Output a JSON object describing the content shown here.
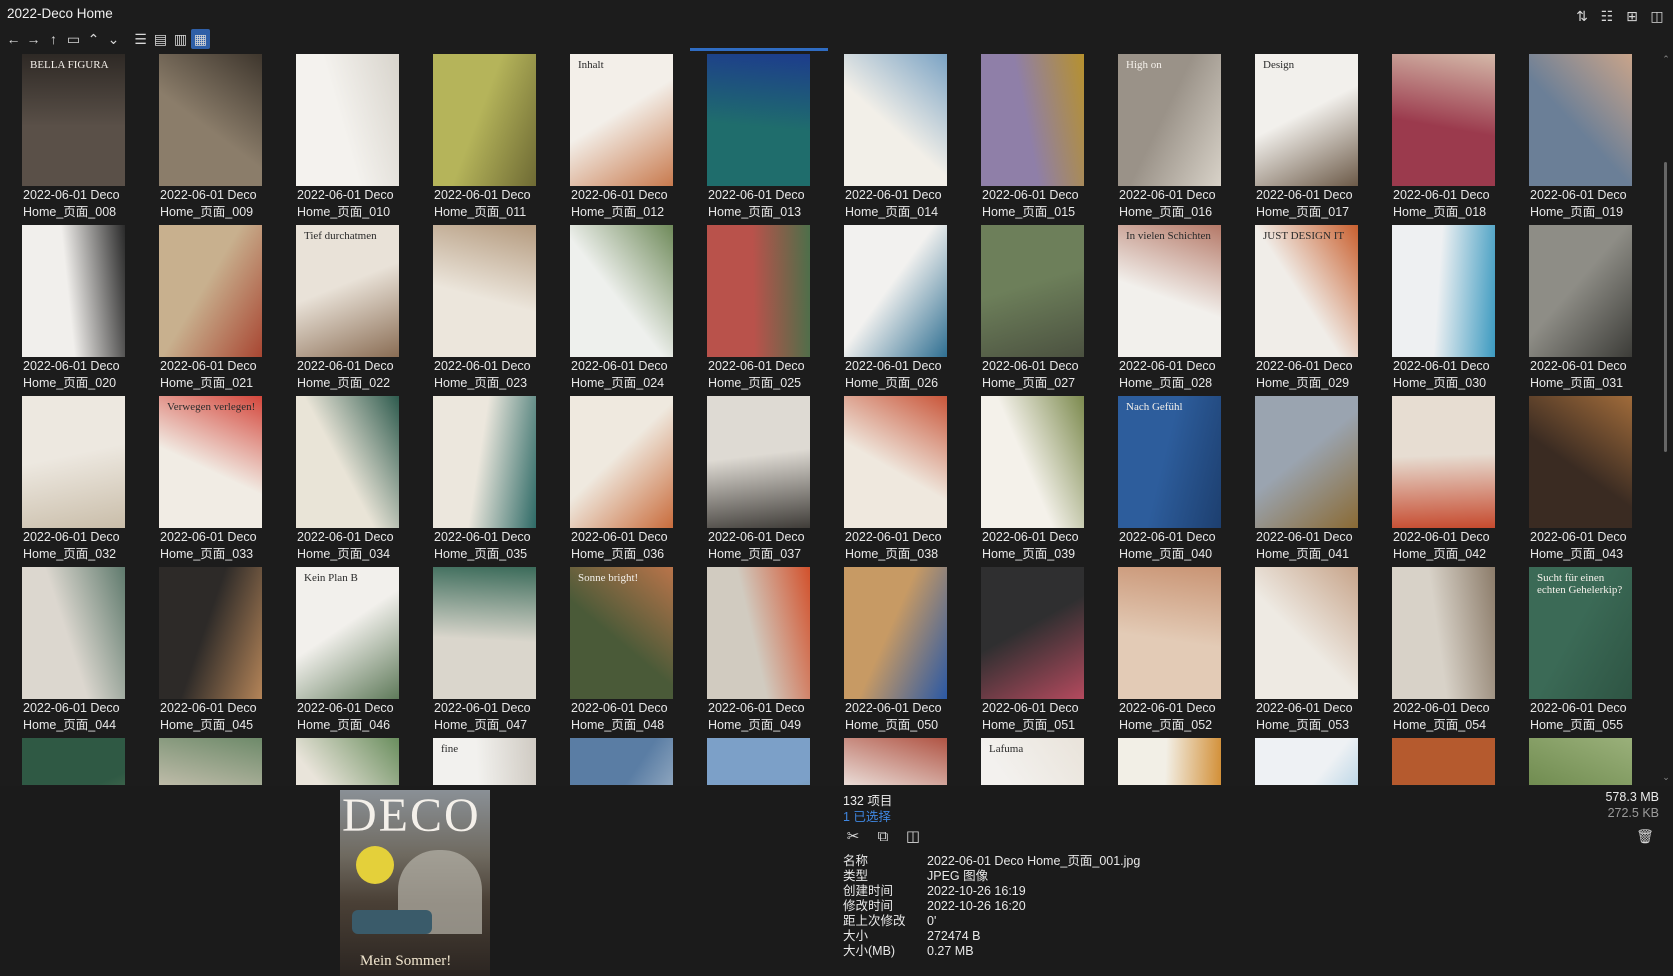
{
  "window": {
    "title": "2022-Deco Home"
  },
  "toolbar": {
    "nav": [
      {
        "name": "back-icon",
        "glyph": "←"
      },
      {
        "name": "forward-icon",
        "glyph": "→"
      },
      {
        "name": "up-icon",
        "glyph": "↑"
      },
      {
        "name": "new-folder-icon",
        "glyph": "▭"
      },
      {
        "name": "chevron-up-icon",
        "glyph": "⌃"
      },
      {
        "name": "chevron-down-icon",
        "glyph": "⌄"
      }
    ],
    "views": [
      {
        "name": "list-view-icon",
        "glyph": "☰",
        "active": false
      },
      {
        "name": "details-view-icon",
        "glyph": "▤",
        "active": false
      },
      {
        "name": "tiles-view-icon",
        "glyph": "▥",
        "active": false
      },
      {
        "name": "grid-view-icon",
        "glyph": "▦",
        "active": true
      }
    ]
  },
  "window_actions": [
    {
      "name": "sort-icon",
      "glyph": "⇅"
    },
    {
      "name": "tree-view-icon",
      "glyph": "☷"
    },
    {
      "name": "add-pane-icon",
      "glyph": "⊞"
    },
    {
      "name": "layout-icon",
      "glyph": "◫"
    }
  ],
  "files": [
    {
      "line1": "2022-06-01 Deco",
      "line2": "Home_页面_008",
      "c1": "#5a5048",
      "c2": "#2e2925",
      "text": "BELLA FIGURA"
    },
    {
      "line1": "2022-06-01 Deco",
      "line2": "Home_页面_009",
      "c1": "#8b7d6a",
      "c2": "#3e362d",
      "text": ""
    },
    {
      "line1": "2022-06-01 Deco",
      "line2": "Home_页面_010",
      "c1": "#f4f2ee",
      "c2": "#d8d4cc",
      "text": ""
    },
    {
      "line1": "2022-06-01 Deco",
      "line2": "Home_页面_011",
      "c1": "#b5b45a",
      "c2": "#6e6a34",
      "text": ""
    },
    {
      "line1": "2022-06-01 Deco",
      "line2": "Home_页面_012",
      "c1": "#f3efe9",
      "c2": "#c87a4e",
      "text": "Inhalt"
    },
    {
      "line1": "2022-06-01 Deco",
      "line2": "Home_页面_013",
      "c1": "#1f6d6c",
      "c2": "#1d3c8c",
      "text": ""
    },
    {
      "line1": "2022-06-01 Deco",
      "line2": "Home_页面_014",
      "c1": "#f2efe8",
      "c2": "#7ba3c4",
      "text": ""
    },
    {
      "line1": "2022-06-01 Deco",
      "line2": "Home_页面_015",
      "c1": "#8f7fa8",
      "c2": "#b6912e",
      "text": ""
    },
    {
      "line1": "2022-06-01 Deco",
      "line2": "Home_页面_016",
      "c1": "#9a9288",
      "c2": "#d8d2c8",
      "text": "High on"
    },
    {
      "line1": "2022-06-01 Deco",
      "line2": "Home_页面_017",
      "c1": "#f2f0ec",
      "c2": "#6c5a48",
      "text": "Design"
    },
    {
      "line1": "2022-06-01 Deco",
      "line2": "Home_页面_018",
      "c1": "#9b3a4d",
      "c2": "#d4b8a8",
      "text": ""
    },
    {
      "line1": "2022-06-01 Deco",
      "line2": "Home_页面_019",
      "c1": "#6b7f97",
      "c2": "#c9a48a",
      "text": ""
    },
    {
      "line1": "2022-06-01 Deco",
      "line2": "Home_页面_020",
      "c1": "#f1efec",
      "c2": "#2a2a2a",
      "text": ""
    },
    {
      "line1": "2022-06-01 Deco",
      "line2": "Home_页面_021",
      "c1": "#c8b08e",
      "c2": "#a84632",
      "text": ""
    },
    {
      "line1": "2022-06-01 Deco",
      "line2": "Home_页面_022",
      "c1": "#e9e2d8",
      "c2": "#8a6d54",
      "text": "Tief durchatmen"
    },
    {
      "line1": "2022-06-01 Deco",
      "line2": "Home_页面_023",
      "c1": "#ece6dc",
      "c2": "#b49a7e",
      "text": ""
    },
    {
      "line1": "2022-06-01 Deco",
      "line2": "Home_页面_024",
      "c1": "#eef0ed",
      "c2": "#6f8a5a",
      "text": ""
    },
    {
      "line1": "2022-06-01 Deco",
      "line2": "Home_页面_025",
      "c1": "#b9524b",
      "c2": "#4d6f4a",
      "text": ""
    },
    {
      "line1": "2022-06-01 Deco",
      "line2": "Home_页面_026",
      "c1": "#f2f1ef",
      "c2": "#2f6f92",
      "text": ""
    },
    {
      "line1": "2022-06-01 Deco",
      "line2": "Home_页面_027",
      "c1": "#6d7f5a",
      "c2": "#4b5140",
      "text": ""
    },
    {
      "line1": "2022-06-01 Deco",
      "line2": "Home_页面_028",
      "c1": "#f2f0ec",
      "c2": "#b57968",
      "text": "In vielen Schichten"
    },
    {
      "line1": "2022-06-01 Deco",
      "line2": "Home_页面_029",
      "c1": "#f0ede8",
      "c2": "#c9602f",
      "text": "JUST DESIGN IT"
    },
    {
      "line1": "2022-06-01 Deco",
      "line2": "Home_页面_030",
      "c1": "#eef0f2",
      "c2": "#3c9ac0",
      "text": ""
    },
    {
      "line1": "2022-06-01 Deco",
      "line2": "Home_页面_031",
      "c1": "#8e8d86",
      "c2": "#3c3c38",
      "text": ""
    },
    {
      "line1": "2022-06-01 Deco",
      "line2": "Home_页面_032",
      "c1": "#ede8e0",
      "c2": "#c9bda9",
      "text": ""
    },
    {
      "line1": "2022-06-01 Deco",
      "line2": "Home_页面_033",
      "c1": "#f1ece4",
      "c2": "#d4473c",
      "text": "Verwegen verlegen!"
    },
    {
      "line1": "2022-06-01 Deco",
      "line2": "Home_页面_034",
      "c1": "#e9e4d7",
      "c2": "#2e5b4e",
      "text": ""
    },
    {
      "line1": "2022-06-01 Deco",
      "line2": "Home_页面_035",
      "c1": "#ece7dd",
      "c2": "#2e6a66",
      "text": ""
    },
    {
      "line1": "2022-06-01 Deco",
      "line2": "Home_页面_036",
      "c1": "#efe9df",
      "c2": "#c96c3c",
      "text": ""
    },
    {
      "line1": "2022-06-01 Deco",
      "line2": "Home_页面_037",
      "c1": "#dedad3",
      "c2": "#3f3c38",
      "text": ""
    },
    {
      "line1": "2022-06-01 Deco",
      "line2": "Home_页面_038",
      "c1": "#efe8de",
      "c2": "#c9563a",
      "text": ""
    },
    {
      "line1": "2022-06-01 Deco",
      "line2": "Home_页面_039",
      "c1": "#f4f1ea",
      "c2": "#7c8a4e",
      "text": ""
    },
    {
      "line1": "2022-06-01 Deco",
      "line2": "Home_页面_040",
      "c1": "#2d5d9c",
      "c2": "#1d3f6f",
      "text": "Nach Gefühl"
    },
    {
      "line1": "2022-06-01 Deco",
      "line2": "Home_页面_041",
      "c1": "#9aa4b0",
      "c2": "#8a6a34",
      "text": ""
    },
    {
      "line1": "2022-06-01 Deco",
      "line2": "Home_页面_042",
      "c1": "#e7ddd2",
      "c2": "#c64a2e",
      "text": ""
    },
    {
      "line1": "2022-06-01 Deco",
      "line2": "Home_页面_043",
      "c1": "#3a2b22",
      "c2": "#a06b3a",
      "text": ""
    },
    {
      "line1": "2022-06-01 Deco",
      "line2": "Home_页面_044",
      "c1": "#dcd7cf",
      "c2": "#5f7a6d",
      "text": ""
    },
    {
      "line1": "2022-06-01 Deco",
      "line2": "Home_页面_045",
      "c1": "#2d2a28",
      "c2": "#b48458",
      "text": ""
    },
    {
      "line1": "2022-06-01 Deco",
      "line2": "Home_页面_046",
      "c1": "#f2f0ec",
      "c2": "#5f7a5a",
      "text": "Kein Plan B"
    },
    {
      "line1": "2022-06-01 Deco",
      "line2": "Home_页面_047",
      "c1": "#dad6cc",
      "c2": "#3b6b5a",
      "text": ""
    },
    {
      "line1": "2022-06-01 Deco",
      "line2": "Home_页面_048",
      "c1": "#4a5a38",
      "c2": "#b9744a",
      "text": "Sonne bright!"
    },
    {
      "line1": "2022-06-01 Deco",
      "line2": "Home_页面_049",
      "c1": "#d1cbc0",
      "c2": "#d2512c",
      "text": ""
    },
    {
      "line1": "2022-06-01 Deco",
      "line2": "Home_页面_050",
      "c1": "#c79a64",
      "c2": "#2a58a4",
      "text": ""
    },
    {
      "line1": "2022-06-01 Deco",
      "line2": "Home_页面_051",
      "c1": "#2f2f30",
      "c2": "#b44a5e",
      "text": ""
    },
    {
      "line1": "2022-06-01 Deco",
      "line2": "Home_页面_052",
      "c1": "#e3cbb6",
      "c2": "#c99474",
      "text": ""
    },
    {
      "line1": "2022-06-01 Deco",
      "line2": "Home_页面_053",
      "c1": "#eeeae3",
      "c2": "#c7a48a",
      "text": ""
    },
    {
      "line1": "2022-06-01 Deco",
      "line2": "Home_页面_054",
      "c1": "#d8d2c8",
      "c2": "#8c7c6a",
      "text": ""
    },
    {
      "line1": "2022-06-01 Deco",
      "line2": "Home_页面_055",
      "c1": "#3b6a56",
      "c2": "#2e5443",
      "text": "Sucht für einen echten Gehelerkip?"
    },
    {
      "line1": "",
      "line2": "",
      "c1": "#2f5944",
      "c2": "#7f9a6e",
      "text": ""
    },
    {
      "line1": "",
      "line2": "",
      "c1": "#cfc6b6",
      "c2": "#6e8a6a",
      "text": ""
    },
    {
      "line1": "",
      "line2": "",
      "c1": "#e9e4da",
      "c2": "#6a8e5e",
      "text": ""
    },
    {
      "line1": "",
      "line2": "",
      "c1": "#f2f1ee",
      "c2": "#cfcac2",
      "text": "fine"
    },
    {
      "line1": "",
      "line2": "",
      "c1": "#5a7da4",
      "c2": "#c8d3dc",
      "text": ""
    },
    {
      "line1": "",
      "line2": "",
      "c1": "#7ca0c8",
      "c2": "#5a7f4a",
      "text": ""
    },
    {
      "line1": "",
      "line2": "",
      "c1": "#f1eeea",
      "c2": "#b05444",
      "text": ""
    },
    {
      "line1": "",
      "line2": "",
      "c1": "#f3f1ee",
      "c2": "#e9e3da",
      "text": "Lafuma"
    },
    {
      "line1": "",
      "line2": "",
      "c1": "#f2efe6",
      "c2": "#d18b2f",
      "text": ""
    },
    {
      "line1": "",
      "line2": "",
      "c1": "#eef1f4",
      "c2": "#7ab4d6",
      "text": ""
    },
    {
      "line1": "",
      "line2": "",
      "c1": "#b55a2e",
      "c2": "#3e5a8a",
      "text": ""
    },
    {
      "line1": "",
      "line2": "",
      "c1": "#6e8a4e",
      "c2": "#9ab07a",
      "text": ""
    }
  ],
  "preview": {
    "title": "DECO",
    "footer": "Mein Sommer!"
  },
  "status": {
    "count": "132 项目",
    "selected": "1 已选择",
    "total_size": "578.3 MB",
    "selected_size": "272.5 KB"
  },
  "info_actions": [
    {
      "name": "cut-icon",
      "glyph": "✂"
    },
    {
      "name": "copy-icon",
      "glyph": "⧉"
    },
    {
      "name": "compare-icon",
      "glyph": "◫"
    }
  ],
  "properties": [
    {
      "key": "名称",
      "value": "2022-06-01 Deco Home_页面_001.jpg"
    },
    {
      "key": "类型",
      "value": "JPEG 图像"
    },
    {
      "key": "创建时间",
      "value": "2022-10-26  16:19"
    },
    {
      "key": "修改时间",
      "value": "2022-10-26  16:20"
    },
    {
      "key": "距上次修改",
      "value": "0'"
    },
    {
      "key": "大小",
      "value": "272474 B"
    },
    {
      "key": "大小(MB)",
      "value": "0.27 MB"
    }
  ]
}
